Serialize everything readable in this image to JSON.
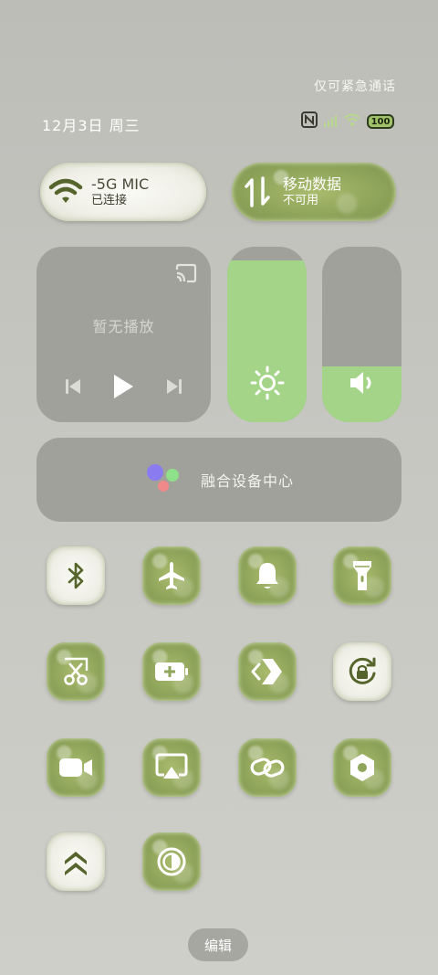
{
  "status_bar": {
    "emergency_text": "仅可紧急通话",
    "date": "12月3日 周三",
    "battery": "100"
  },
  "wifi": {
    "name": "-5G   MIC",
    "status": "已连接"
  },
  "mobile_data": {
    "title": "移动数据",
    "status": "不可用"
  },
  "media": {
    "now_playing": "暂无播放"
  },
  "brightness": {
    "level": 0.92
  },
  "volume": {
    "level": 0.32
  },
  "fusion": {
    "label": "融合设备中心"
  },
  "toggles": [
    {
      "name": "bluetooth",
      "icon": "bluetooth-icon",
      "active": false
    },
    {
      "name": "airplane-mode",
      "icon": "airplane-icon",
      "active": true
    },
    {
      "name": "sound",
      "icon": "bell-icon",
      "active": true
    },
    {
      "name": "flashlight",
      "icon": "flashlight-icon",
      "active": true
    },
    {
      "name": "screenshot",
      "icon": "scissors-icon",
      "active": true
    },
    {
      "name": "battery-saver",
      "icon": "battery-plus-icon",
      "active": true
    },
    {
      "name": "nearby-share",
      "icon": "share-arrows-icon",
      "active": true
    },
    {
      "name": "auto-rotate",
      "icon": "rotation-lock-icon",
      "active": false
    },
    {
      "name": "screen-record",
      "icon": "video-camera-icon",
      "active": true
    },
    {
      "name": "screen-cast",
      "icon": "cast-screen-icon",
      "active": true
    },
    {
      "name": "link",
      "icon": "link-icon",
      "active": true
    },
    {
      "name": "settings",
      "icon": "hexagon-nut-icon",
      "active": true
    },
    {
      "name": "performance-mode",
      "icon": "double-chevron-up-icon",
      "active": false
    },
    {
      "name": "dark-mode",
      "icon": "contrast-icon",
      "active": true
    }
  ],
  "edit_label": "编辑",
  "colors": {
    "fur_green": "#8fa55a",
    "fur_white": "#f3f3ec",
    "panel_gray": "#a1a19c",
    "slider_fill": "#a4d487"
  }
}
